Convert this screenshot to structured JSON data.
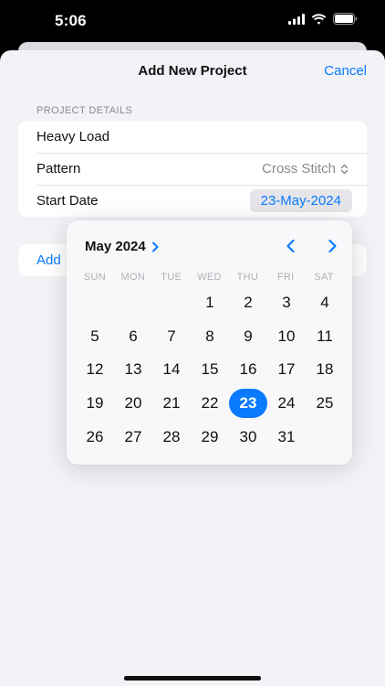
{
  "status": {
    "time": "5:06",
    "icons": [
      "signal-icon",
      "wifi-icon",
      "battery-icon"
    ]
  },
  "nav": {
    "title": "Add New Project",
    "cancel_label": "Cancel"
  },
  "section": {
    "header": "PROJECT DETAILS"
  },
  "form": {
    "name_value": "Heavy Load",
    "pattern_label": "Pattern",
    "pattern_value": "Cross Stitch",
    "start_date_label": "Start Date",
    "start_date_value": "23-May-2024"
  },
  "add_row": {
    "label": "Add"
  },
  "calendar": {
    "month_label": "May 2024",
    "weekdays": [
      "SUN",
      "MON",
      "TUE",
      "WED",
      "THU",
      "FRI",
      "SAT"
    ],
    "days": [
      "",
      "",
      "",
      "1",
      "2",
      "3",
      "4",
      "5",
      "6",
      "7",
      "8",
      "9",
      "10",
      "11",
      "12",
      "13",
      "14",
      "15",
      "16",
      "17",
      "18",
      "19",
      "20",
      "21",
      "22",
      "23",
      "24",
      "25",
      "26",
      "27",
      "28",
      "29",
      "30",
      "31",
      ""
    ],
    "selected_day": "23"
  },
  "colors": {
    "accent": "#0a7aff",
    "background": "#f2f2f7",
    "secondary_text": "#8a8a8e"
  }
}
